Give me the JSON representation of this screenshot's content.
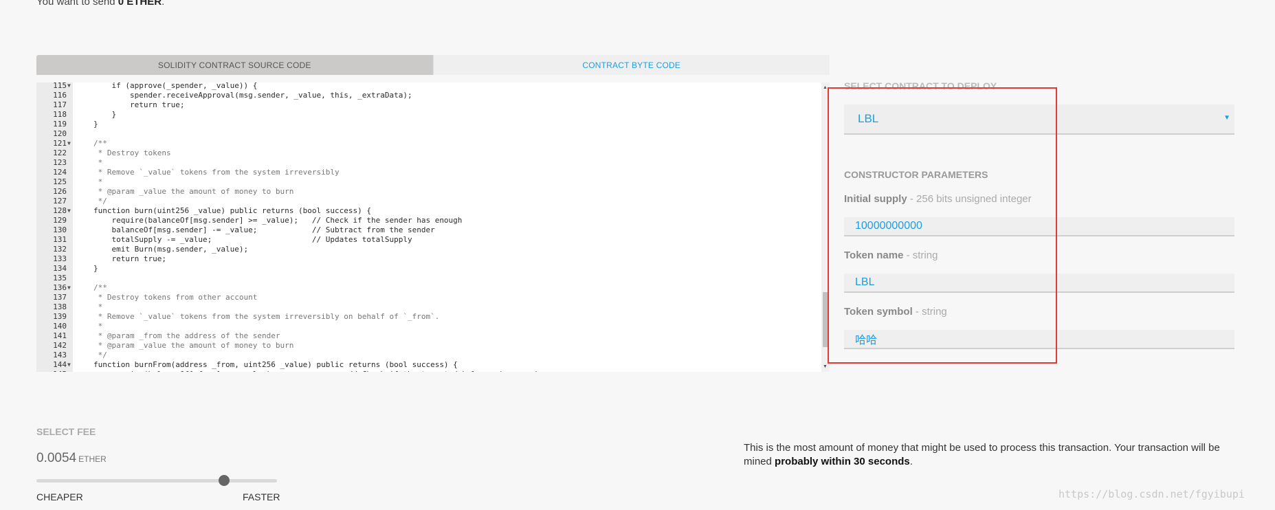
{
  "send_note": {
    "prefix": "You want to send ",
    "amount": "0 ETHER",
    "suffix": "."
  },
  "tabs": [
    {
      "label": "SOLIDITY CONTRACT SOURCE CODE",
      "active": true
    },
    {
      "label": "CONTRACT BYTE CODE",
      "active": false
    }
  ],
  "code": {
    "lines": [
      {
        "n": "115",
        "fold": true,
        "text": "    if (approve(_spender, _value)) {",
        "comment": false
      },
      {
        "n": "116",
        "fold": false,
        "text": "        spender.receiveApproval(msg.sender, _value, this, _extraData);",
        "comment": false
      },
      {
        "n": "117",
        "fold": false,
        "text": "        return true;",
        "comment": false
      },
      {
        "n": "118",
        "fold": false,
        "text": "    }",
        "comment": false
      },
      {
        "n": "119",
        "fold": false,
        "text": "}",
        "comment": false
      },
      {
        "n": "120",
        "fold": false,
        "text": "",
        "comment": false
      },
      {
        "n": "121",
        "fold": true,
        "text": "/**",
        "comment": true
      },
      {
        "n": "122",
        "fold": false,
        "text": " * Destroy tokens",
        "comment": true
      },
      {
        "n": "123",
        "fold": false,
        "text": " *",
        "comment": true
      },
      {
        "n": "124",
        "fold": false,
        "text": " * Remove `_value` tokens from the system irreversibly",
        "comment": true
      },
      {
        "n": "125",
        "fold": false,
        "text": " *",
        "comment": true
      },
      {
        "n": "126",
        "fold": false,
        "text": " * @param _value the amount of money to burn",
        "comment": true
      },
      {
        "n": "127",
        "fold": false,
        "text": " */",
        "comment": true
      },
      {
        "n": "128",
        "fold": true,
        "text": "function burn(uint256 _value) public returns (bool success) {",
        "comment": false
      },
      {
        "n": "129",
        "fold": false,
        "text": "    require(balanceOf[msg.sender] >= _value);   // Check if the sender has enough",
        "comment": false
      },
      {
        "n": "130",
        "fold": false,
        "text": "    balanceOf[msg.sender] -= _value;            // Subtract from the sender",
        "comment": false
      },
      {
        "n": "131",
        "fold": false,
        "text": "    totalSupply -= _value;                      // Updates totalSupply",
        "comment": false
      },
      {
        "n": "132",
        "fold": false,
        "text": "    emit Burn(msg.sender, _value);",
        "comment": false
      },
      {
        "n": "133",
        "fold": false,
        "text": "    return true;",
        "comment": false
      },
      {
        "n": "134",
        "fold": false,
        "text": "}",
        "comment": false
      },
      {
        "n": "135",
        "fold": false,
        "text": "",
        "comment": false
      },
      {
        "n": "136",
        "fold": true,
        "text": "/**",
        "comment": true
      },
      {
        "n": "137",
        "fold": false,
        "text": " * Destroy tokens from other account",
        "comment": true
      },
      {
        "n": "138",
        "fold": false,
        "text": " *",
        "comment": true
      },
      {
        "n": "139",
        "fold": false,
        "text": " * Remove `_value` tokens from the system irreversibly on behalf of `_from`.",
        "comment": true
      },
      {
        "n": "140",
        "fold": false,
        "text": " *",
        "comment": true
      },
      {
        "n": "141",
        "fold": false,
        "text": " * @param _from the address of the sender",
        "comment": true
      },
      {
        "n": "142",
        "fold": false,
        "text": " * @param _value the amount of money to burn",
        "comment": true
      },
      {
        "n": "143",
        "fold": false,
        "text": " */",
        "comment": true
      },
      {
        "n": "144",
        "fold": true,
        "text": "function burnFrom(address _from, uint256 _value) public returns (bool success) {",
        "comment": false
      },
      {
        "n": "145",
        "fold": false,
        "text": "    require(balanceOf[_from] >= _value);                // Check if the targeted balance is enough",
        "comment": false
      }
    ]
  },
  "deploy": {
    "select_label": "SELECT CONTRACT TO DEPLOY",
    "selected_contract": "LBL",
    "constructor_title": "CONSTRUCTOR PARAMETERS",
    "params": [
      {
        "name": "Initial supply",
        "type": " - 256 bits unsigned integer",
        "value": "10000000000"
      },
      {
        "name": "Token name",
        "type": " - string",
        "value": "LBL"
      },
      {
        "name": "Token symbol",
        "type": " - string",
        "value": "哈哈"
      }
    ]
  },
  "fee": {
    "label": "SELECT FEE",
    "amount": "0.0054",
    "unit": "ETHER",
    "slider_fraction": 0.78,
    "cheaper_label": "CHEAPER",
    "faster_label": "FASTER",
    "desc_prefix": "This is the most amount of money that might be used to process this transaction. Your transaction will be mined ",
    "desc_bold": "probably within 30 seconds",
    "desc_suffix": "."
  },
  "watermark": "https://blog.csdn.net/fgyibupi",
  "colors": {
    "accent": "#1e9de0",
    "highlight": "#e53935"
  }
}
